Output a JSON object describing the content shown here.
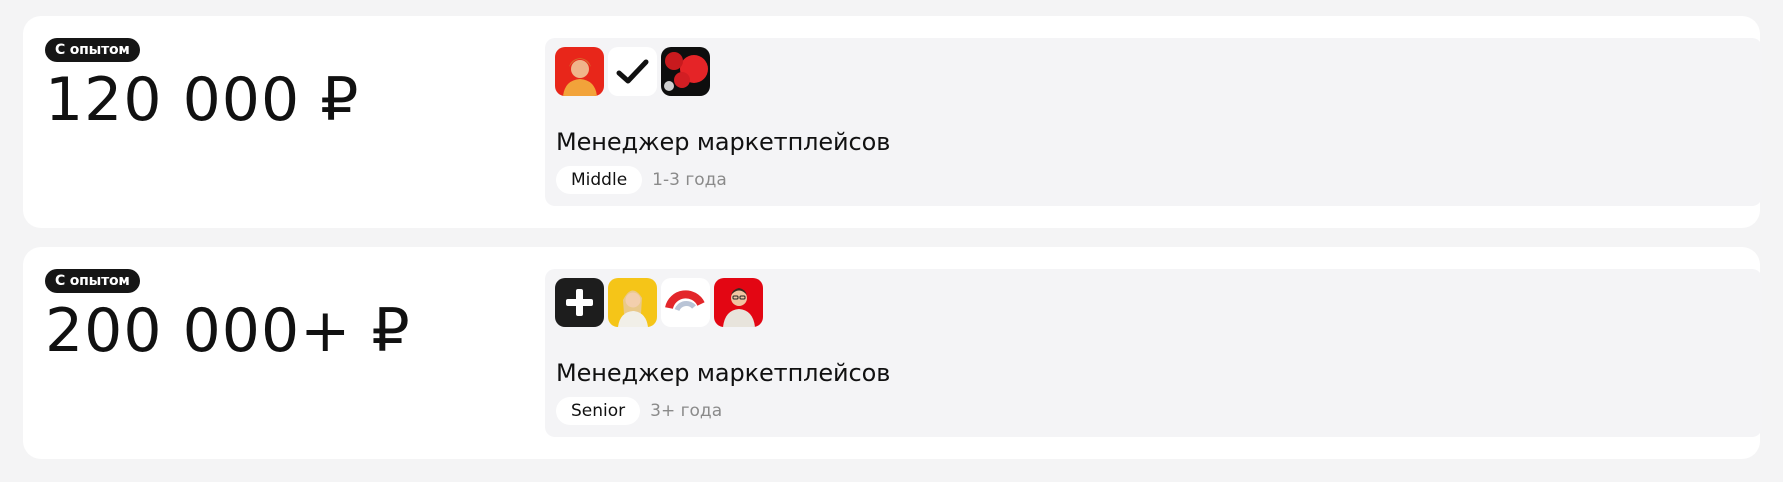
{
  "vacancies": [
    {
      "badge": "С опытом",
      "price": "120 000 ₽",
      "title": "Менеджер маркетплейсов",
      "level": "Middle",
      "experience": "1-3 года",
      "logos": [
        "woman-avatar-red-logo",
        "checkmark-logo",
        "red-balloons-logo"
      ]
    },
    {
      "badge": "С опытом",
      "price": "200 000+ ₽",
      "title": "Менеджер маркетплейсов",
      "level": "Senior",
      "experience": "3+ года",
      "logos": [
        "plus-logo",
        "woman-avatar-yellow-logo",
        "red-arc-logo",
        "man-avatar-red-logo"
      ]
    }
  ],
  "colors": {
    "page_bg": "#f4f4f5",
    "card_bg": "#ffffff",
    "panel_bg": "#f4f4f6",
    "badge_bg": "#161616",
    "brand_red": "#e30613",
    "muted_text": "#8a8a8a"
  }
}
